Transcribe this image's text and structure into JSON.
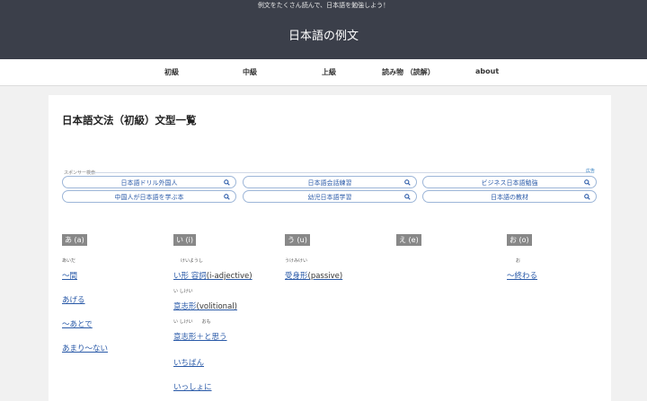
{
  "header": {
    "tagline": "例文をたくさん読んで、日本語を勉強しよう！",
    "site_title": "日本語の例文"
  },
  "nav": {
    "items": [
      "初級",
      "中級",
      "上級",
      "読み物 （読解）",
      "about"
    ]
  },
  "main": {
    "page_title": "日本語文法（初級）文型一覧",
    "sponsor_label": "スポンサー検索",
    "ad_label": "広告",
    "search_pills": [
      "日本語ドリル外国人",
      "日本語会話練習",
      "ビジネス日本語勉強",
      "中国人が日本語を学ぶ本",
      "幼児日本語学習",
      "日本語の教材"
    ],
    "columns": [
      {
        "heading": "あ (a)",
        "entries": [
          {
            "ruby": "あいだ",
            "text": "〜間",
            "suffix": ""
          },
          {
            "ruby": "",
            "text": "あげる",
            "suffix": ""
          },
          {
            "ruby": "",
            "text": "〜あとで",
            "suffix": ""
          },
          {
            "ruby": "",
            "text": "あまり〜ない",
            "suffix": ""
          }
        ]
      },
      {
        "heading": "い (i)",
        "entries": [
          {
            "ruby": "けいようし",
            "text": "い形 容詞",
            "suffix": "(i-adjective)"
          },
          {
            "ruby": "い しけい",
            "text": "意志形",
            "suffix": "(volitional)"
          },
          {
            "ruby": "い しけい　　おも",
            "text": "意志形＋と思う",
            "suffix": ""
          },
          {
            "ruby": "",
            "text": "いちばん",
            "suffix": ""
          },
          {
            "ruby": "",
            "text": "いっしょに",
            "suffix": ""
          }
        ]
      },
      {
        "heading": "う (u)",
        "entries": [
          {
            "ruby": "うけみけい",
            "text": "受身形",
            "suffix": "(passive)"
          }
        ]
      },
      {
        "heading": "え (e)",
        "entries": []
      },
      {
        "heading": "お (o)",
        "entries": [
          {
            "ruby": "お",
            "text": "〜終わる",
            "suffix": ""
          }
        ]
      }
    ]
  },
  "colors": {
    "header_bg": "#3b3f4a",
    "link": "#2a5aa8",
    "column_head_bg": "#888888"
  }
}
